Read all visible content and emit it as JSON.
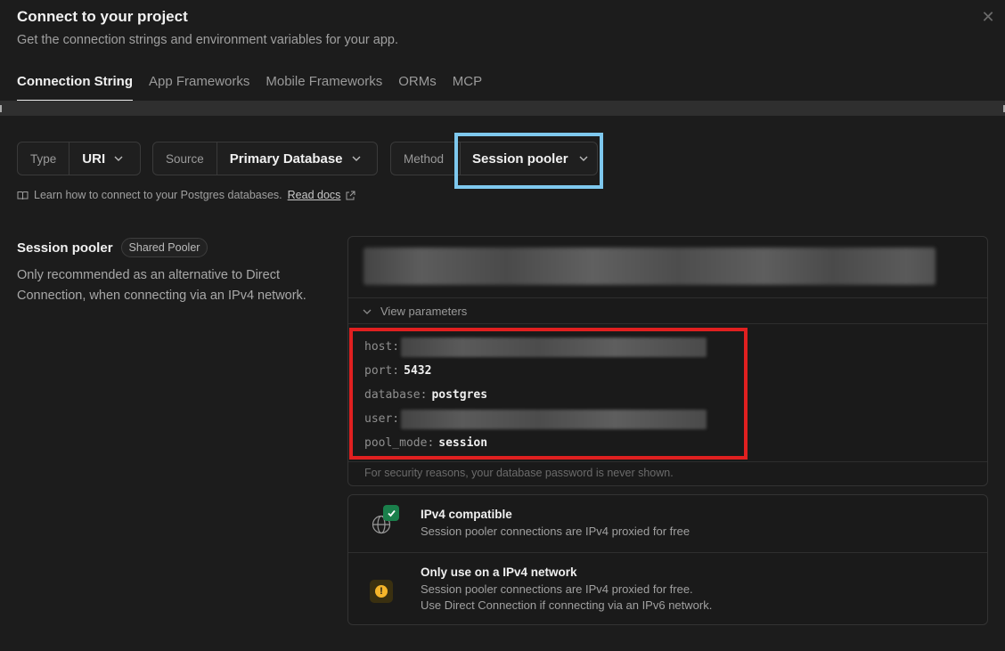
{
  "header": {
    "title": "Connect to your project",
    "subtitle": "Get the connection strings and environment variables for your app.",
    "close_icon": "close-icon"
  },
  "tabs": [
    {
      "label": "Connection String",
      "active": true
    },
    {
      "label": "App Frameworks",
      "active": false
    },
    {
      "label": "Mobile Frameworks",
      "active": false
    },
    {
      "label": "ORMs",
      "active": false
    },
    {
      "label": "MCP",
      "active": false
    }
  ],
  "selectors": {
    "type": {
      "label": "Type",
      "value": "URI"
    },
    "source": {
      "label": "Source",
      "value": "Primary Database"
    },
    "method": {
      "label": "Method",
      "value": "Session pooler"
    }
  },
  "learn": {
    "text": "Learn how to connect to your Postgres databases.",
    "link": "Read docs"
  },
  "pooler": {
    "title": "Session pooler",
    "badge": "Shared Pooler",
    "description": "Only recommended as an alternative to Direct Connection, when connecting via an IPv4 network."
  },
  "panel": {
    "view_parameters": "View parameters",
    "params": [
      {
        "key": "host:",
        "value": null,
        "redacted": true
      },
      {
        "key": "port:",
        "value": "5432",
        "redacted": false
      },
      {
        "key": "database:",
        "value": "postgres",
        "redacted": false
      },
      {
        "key": "user:",
        "value": null,
        "redacted": true
      },
      {
        "key": "pool_mode:",
        "value": "session",
        "redacted": false
      }
    ],
    "security_note": "For security reasons, your database password is never shown."
  },
  "cards": [
    {
      "title": "IPv4 compatible",
      "lines": [
        "Session pooler connections are IPv4 proxied for free"
      ],
      "icon": "globe-check-icon"
    },
    {
      "title": "Only use on a IPv4 network",
      "lines": [
        "Session pooler connections are IPv4 proxied for free.",
        "Use Direct Connection if connecting via an IPv6 network."
      ],
      "icon": "warning-icon"
    }
  ],
  "colors": {
    "background": "#1c1c1c",
    "method_highlight": "#7ec8ee",
    "params_highlight": "#e02020",
    "success": "#1a7f4b",
    "warning": "#f5b52a"
  }
}
